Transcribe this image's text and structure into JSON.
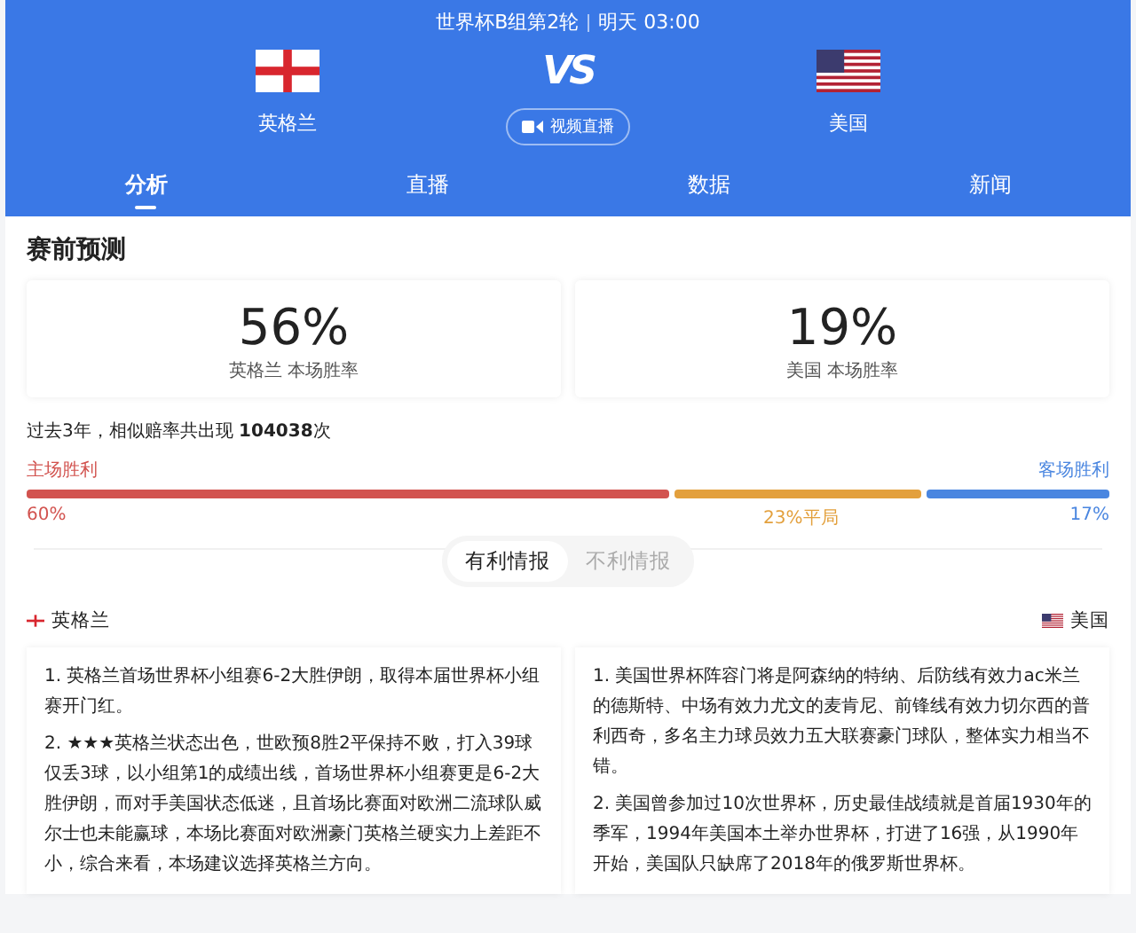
{
  "header": {
    "match_info": "世界杯B组第2轮",
    "time": "明天 03:00",
    "home": {
      "name": "英格兰"
    },
    "away": {
      "name": "美国"
    },
    "vs": "VS",
    "live_button": "视频直播"
  },
  "tabs": [
    {
      "label": "分析",
      "selected": true
    },
    {
      "label": "直播",
      "selected": false
    },
    {
      "label": "数据",
      "selected": false
    },
    {
      "label": "新闻",
      "selected": false
    }
  ],
  "prediction": {
    "title": "赛前预测",
    "cards": [
      {
        "value": "56%",
        "caption": "英格兰 本场胜率"
      },
      {
        "value": "19%",
        "caption": "美国 本场胜率"
      }
    ],
    "history": "过去3年，相似赔率共出现 **104038**次",
    "home_label": "主场胜利",
    "away_label": "客场胜利",
    "segments": [
      {
        "kind": "home",
        "label": "60%",
        "color": "#d2534f"
      },
      {
        "kind": "draw",
        "label": "23%平局",
        "color": "#e3a03d"
      },
      {
        "kind": "away",
        "label": "17%",
        "color": "#4a86e0"
      }
    ]
  },
  "info_tabs": [
    {
      "label": "有利情报",
      "selected": true
    },
    {
      "label": "不利情报",
      "selected": false
    }
  ],
  "teams": [
    {
      "name": "英格兰",
      "items": [
        "1. 英格兰首场世界杯小组赛6-2大胜伊朗，取得本届世界杯小组赛开门红。",
        "2. ★★★英格兰状态出色，世欧预8胜2平保持不败，打入39球仅丢3球，以小组第1的成绩出线，首场世界杯小组赛更是6-2大胜伊朗，而对手美国状态低迷，且首场比赛面对欧洲二流球队威尔士也未能赢球，本场比赛面对欧洲豪门英格兰硬实力上差距不小，综合来看，本场建议选择英格兰方向。"
      ]
    },
    {
      "name": "美国",
      "items": [
        "1. 美国世界杯阵容门将是阿森纳的特纳、后防线有效力ac米兰的德斯特、中场有效力尤文的麦肯尼、前锋线有效力切尔西的普利西奇，多名主力球员效力五大联赛豪门球队，整体实力相当不错。",
        "2. 美国曾参加过10次世界杯，历史最佳战绩就是首届1930年的季军，1994年美国本土举办世界杯，打进了16强，从1990年开始，美国队只缺席了2018年的俄罗斯世界杯。"
      ]
    }
  ]
}
